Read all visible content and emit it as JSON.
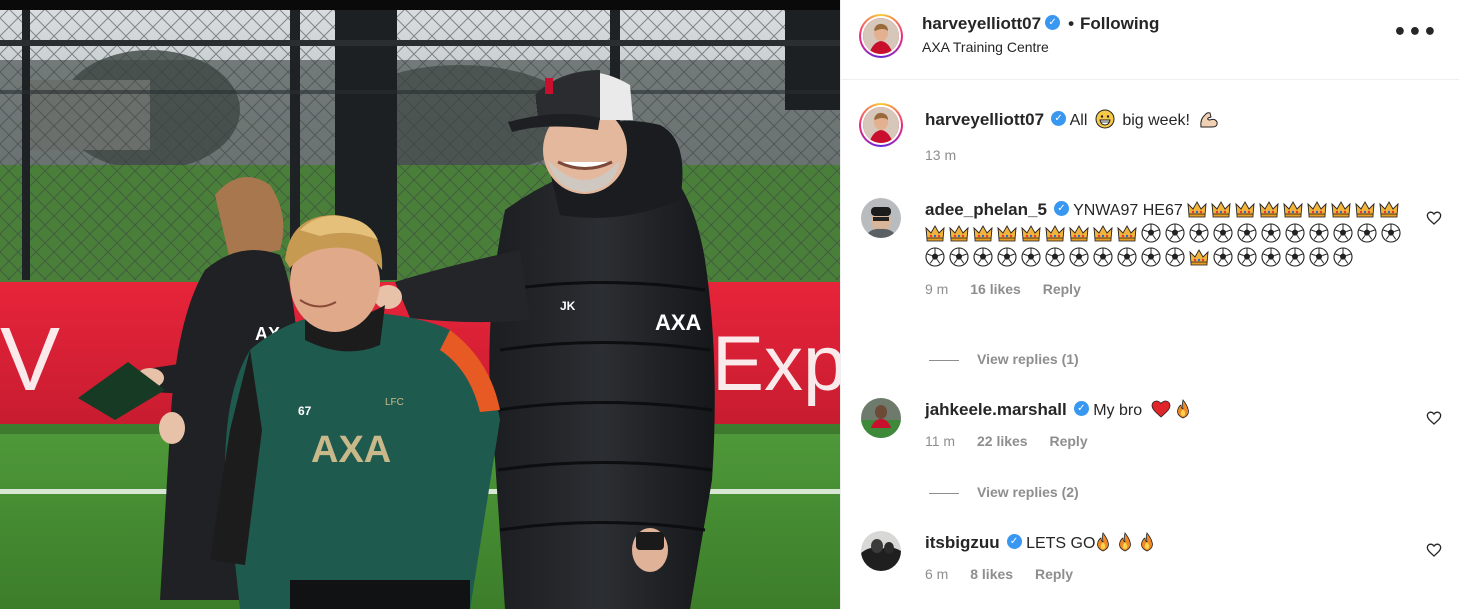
{
  "post": {
    "author": "harveyelliott07",
    "follow_state": "Following",
    "separator": "•",
    "location": "AXA Training Centre",
    "more_icon": "more-options-icon",
    "more_glyph": "•••",
    "caption": {
      "username": "harveyelliott07",
      "text_before": "All",
      "text_after": "big week!",
      "time": "13 m"
    }
  },
  "photo": {
    "description_icons": [
      "player-figure",
      "coach-figure"
    ],
    "shirt_number": "67",
    "sponsor": "AXA",
    "banner_text": "Exp",
    "coach_initials": "JK"
  },
  "comments": [
    {
      "username": "adee_phelan_5",
      "text": "YNWA97 HE67",
      "emoji_sequence": "crown x8, crown x10, soccer x8, soccer x14, crown, soccer x5, soccer",
      "time": "9 m",
      "likes": "16 likes",
      "reply": "Reply",
      "view_replies": "View replies (1)"
    },
    {
      "username": "jahkeele.marshall",
      "text": "My bro",
      "time": "11 m",
      "likes": "22 likes",
      "reply": "Reply",
      "view_replies": "View replies (2)"
    },
    {
      "username": "itsbigzuu",
      "text": "LETS GO",
      "time": "6 m",
      "likes": "8 likes",
      "reply": "Reply"
    }
  ],
  "colors": {
    "verified": "#3897f0",
    "muted": "#8e8e8e",
    "text": "#262626",
    "divider": "#efefef"
  }
}
